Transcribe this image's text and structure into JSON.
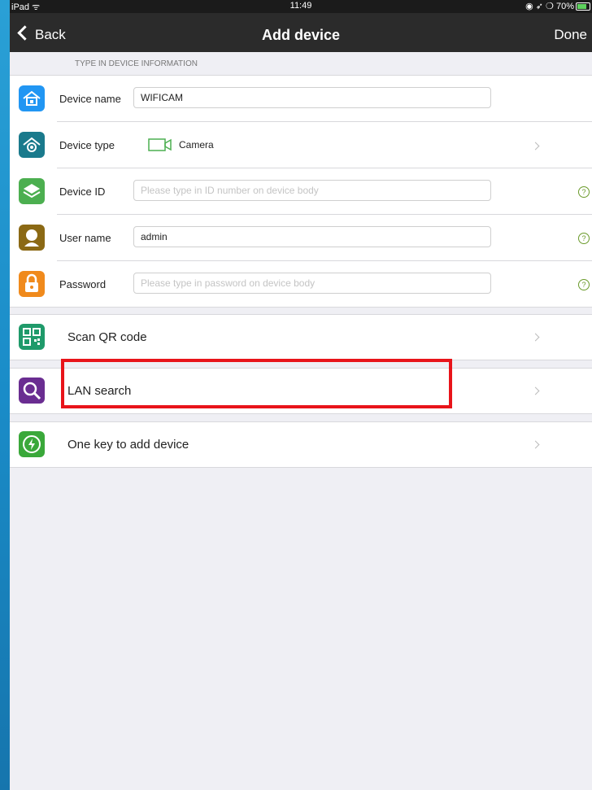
{
  "status": {
    "left": "iPad ᯤ",
    "time": "11:49",
    "right": "◉ ➶ ❍ 70%"
  },
  "nav": {
    "back": "Back",
    "title": "Add device",
    "done": "Done"
  },
  "section_header": "TYPE IN DEVICE INFORMATION",
  "form": {
    "device_name": {
      "label": "Device name",
      "value": "WIFICAM"
    },
    "device_type": {
      "label": "Device type",
      "value": "Camera"
    },
    "device_id": {
      "label": "Device ID",
      "placeholder": "Please type in ID number on device body"
    },
    "user_name": {
      "label": "User name",
      "value": "admin"
    },
    "password": {
      "label": "Password",
      "placeholder": "Please type in password on device body"
    },
    "help": "?"
  },
  "actions": {
    "scan_qr": "Scan QR code",
    "lan_search": "LAN search",
    "one_key": "One key to add device"
  },
  "colors": {
    "accent_highlight": "#e8141a",
    "icon_blue": "#2196f3",
    "icon_teal": "#1a7a8c",
    "icon_green": "#4caf50",
    "icon_brown": "#8b6914",
    "icon_orange": "#f08a1c",
    "icon_purple": "#6a2d91"
  },
  "icons": {
    "device_name": "house-icon",
    "device_type": "camera-house-icon",
    "device_id": "layers-icon",
    "user_name": "user-icon",
    "password": "lock-icon",
    "scan_qr": "qr-code-icon",
    "lan_search": "magnifier-icon",
    "one_key": "lightning-icon"
  }
}
